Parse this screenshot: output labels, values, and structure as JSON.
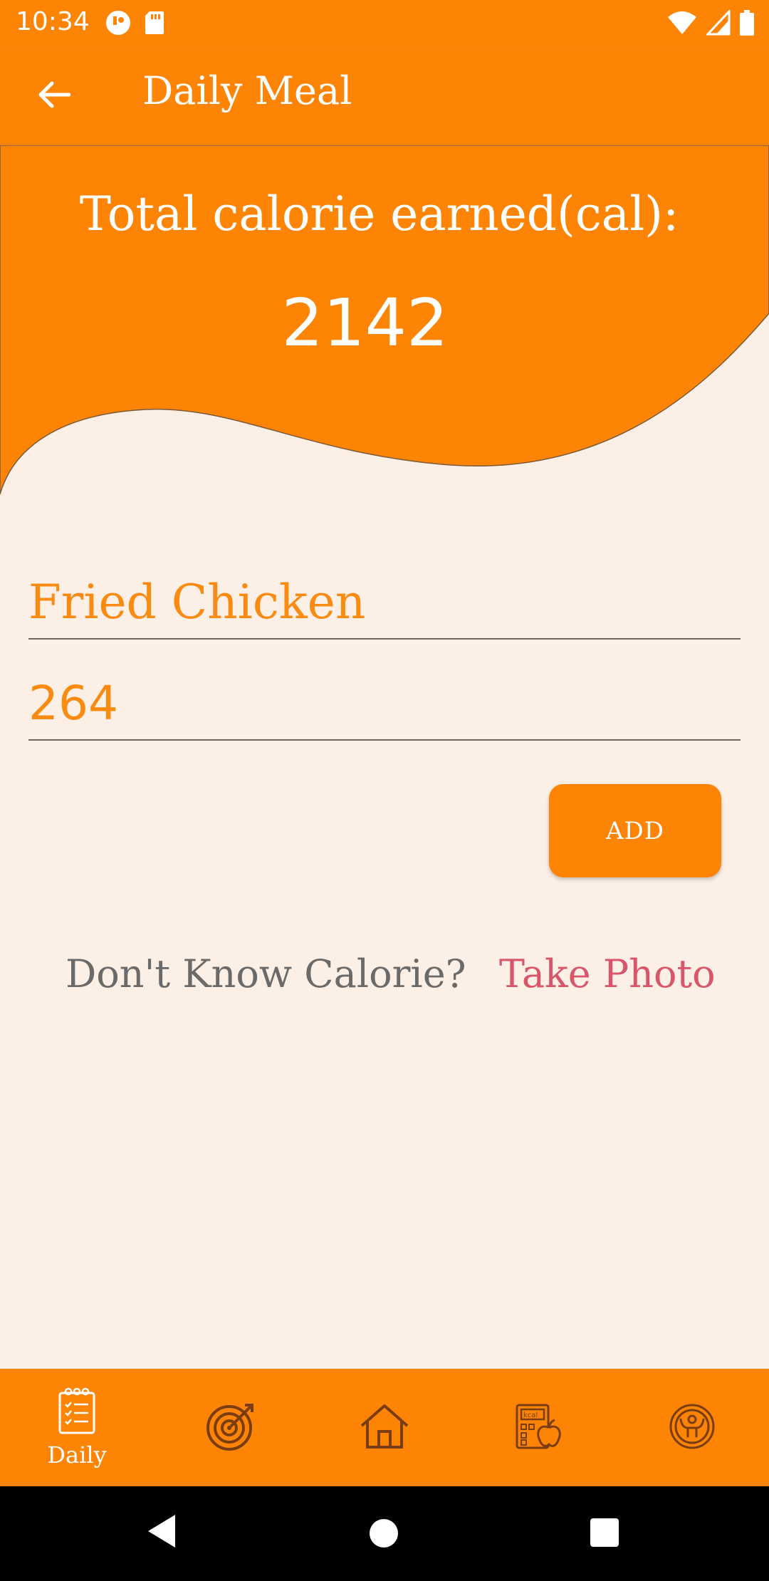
{
  "status_bar": {
    "time": "10:34",
    "left_icons": [
      "app-notification-icon",
      "sd-card-icon"
    ],
    "right_icons": [
      "wifi-icon",
      "cellular-signal-icon",
      "battery-icon"
    ]
  },
  "app_bar": {
    "title": "Daily Meal",
    "back_icon": "arrow-left-icon"
  },
  "header": {
    "label": "Total calorie earned(cal):",
    "total": "2142"
  },
  "form": {
    "food_name_value": "Fried Chicken",
    "calorie_value": "264",
    "add_label": "ADD"
  },
  "photo_prompt": {
    "question": "Don't Know Calorie?",
    "link": "Take Photo"
  },
  "bottom_nav": {
    "items": [
      {
        "label": "Daily",
        "icon": "checklist-icon",
        "selected": true
      },
      {
        "label": "",
        "icon": "target-icon",
        "selected": false
      },
      {
        "label": "",
        "icon": "home-icon",
        "selected": false
      },
      {
        "label": "",
        "icon": "calorie-calculator-icon",
        "selected": false
      },
      {
        "label": "",
        "icon": "fitness-icon",
        "selected": false
      }
    ]
  },
  "colors": {
    "accent": "#fd8405",
    "background": "#fcf0e6",
    "input_text": "#f98b12",
    "link": "#d9566a",
    "muted_text": "#6c6a69",
    "nav_icon": "#7a3d12"
  }
}
